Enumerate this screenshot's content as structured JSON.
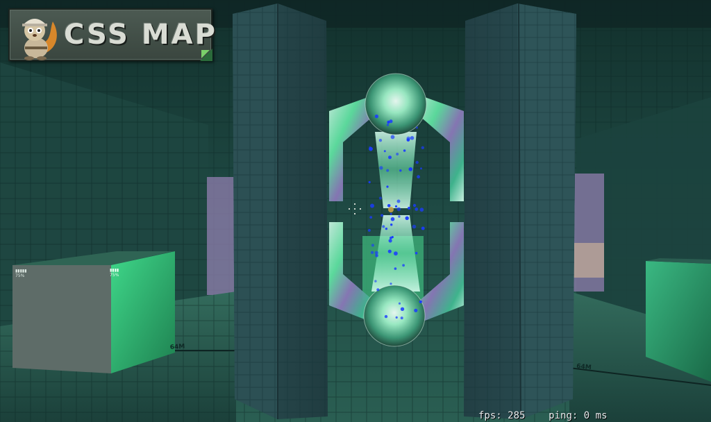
{
  "logo": {
    "title": "CSS MAP",
    "mascot_icon": "squirrel-mascot-icon"
  },
  "hud": {
    "fps_label": "fps:",
    "fps_value": "285",
    "ping_label": "ping:",
    "ping_value": "0",
    "ping_unit": "ms"
  },
  "scene": {
    "colors": {
      "wall": "#1f4a44",
      "wall_dark": "#143230",
      "floor": "#2b5e52",
      "pillar": "#2a4f52",
      "glow": "#5cf0a0",
      "particles": "#1a3cff",
      "crate_green": "#3cb878",
      "crate_grey": "#5a6864"
    },
    "crate_labels": [
      "75%",
      "75%"
    ],
    "floor_markings": [
      "64M",
      "64M"
    ]
  }
}
